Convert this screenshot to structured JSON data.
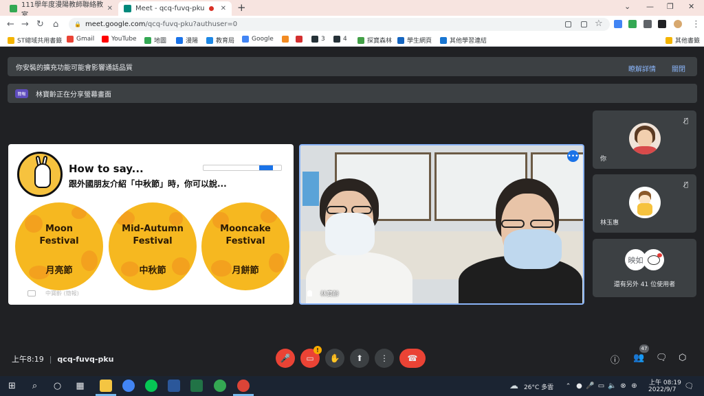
{
  "browser": {
    "tabs": [
      {
        "title": "111學年度漫陽教師聯絡教室",
        "favicon_color": "#34a853"
      },
      {
        "title": "Meet - qcq-fuvq-pku",
        "favicon_color": "#00897b"
      }
    ],
    "url_domain": "meet.google.com",
    "url_path": "/qcq-fuvq-pku?authuser=0",
    "bookmarks": [
      {
        "label": "ST總域共用書籤",
        "color": "#f4b400"
      },
      {
        "label": "Gmail",
        "color": "#ea4335"
      },
      {
        "label": "YouTube",
        "color": "#ff0000"
      },
      {
        "label": "地圖",
        "color": "#34a853"
      },
      {
        "label": "漫陽",
        "color": "#1a73e8"
      },
      {
        "label": "教育局",
        "color": "#1e88e5"
      },
      {
        "label": "Google",
        "color": "#4285f4"
      },
      {
        "label": "",
        "color": "#f28b22"
      },
      {
        "label": "",
        "color": "#d32f2f"
      },
      {
        "label": "3",
        "color": "#263238"
      },
      {
        "label": "4",
        "color": "#263238"
      },
      {
        "label": "探寶森林",
        "color": "#43a047"
      },
      {
        "label": "學生網頁",
        "color": "#1565c0"
      },
      {
        "label": "其他學習連結",
        "color": "#1976d2"
      }
    ],
    "other_bookmarks": "其他書籤"
  },
  "meet": {
    "notice_extension": "你安裝的擴充功能可能會影響通話品質",
    "notice_learn_more": "瞭解詳情",
    "notice_close": "關閉",
    "presenting_badge": "簡報",
    "presenting_text": "林寶齡正在分享螢幕畫面",
    "slide": {
      "title": "How to say...",
      "subtitle": "跟外國朋友介紹「中秋節」時，你可以說...",
      "moons": [
        {
          "en": [
            "Moon",
            "Festival"
          ],
          "zh": "月亮節"
        },
        {
          "en": [
            "Mid-Autumn",
            "Festival"
          ],
          "zh": "中秋節"
        },
        {
          "en": [
            "Mooncake",
            "Festival"
          ],
          "zh": "月餅節"
        }
      ],
      "caption": "中寶齡 (簡報)"
    },
    "main_video_name": "林寶齡",
    "participants": [
      {
        "name": "你"
      },
      {
        "name": "林玉惠"
      }
    ],
    "others_avatar_text": "映如",
    "others_text": "還有另外 41 位使用者",
    "time": "上午8:19",
    "meeting_code": "qcq-fuvq-pku",
    "camera_warning": "!",
    "participant_count": "47"
  },
  "taskbar": {
    "weather": "26°C 多雲",
    "clock_time": "上午 08:19",
    "clock_date": "2022/9/7"
  }
}
